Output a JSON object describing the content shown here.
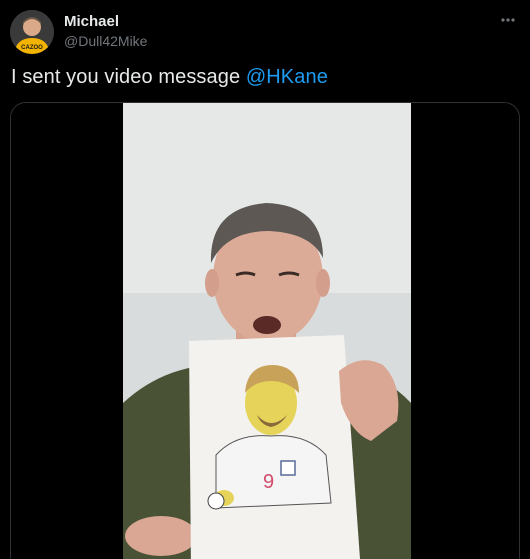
{
  "tweet": {
    "author_name": "Michael",
    "author_handle": "@Dull42Mike",
    "text": "I sent you video message ",
    "mention": "@HKane",
    "avatar_badge": "CAZOO"
  },
  "icons": {
    "more": "more-dots-icon"
  },
  "colors": {
    "background": "#000000",
    "text": "#e7e9ea",
    "secondary": "#71767b",
    "link": "#1d9bf0"
  }
}
